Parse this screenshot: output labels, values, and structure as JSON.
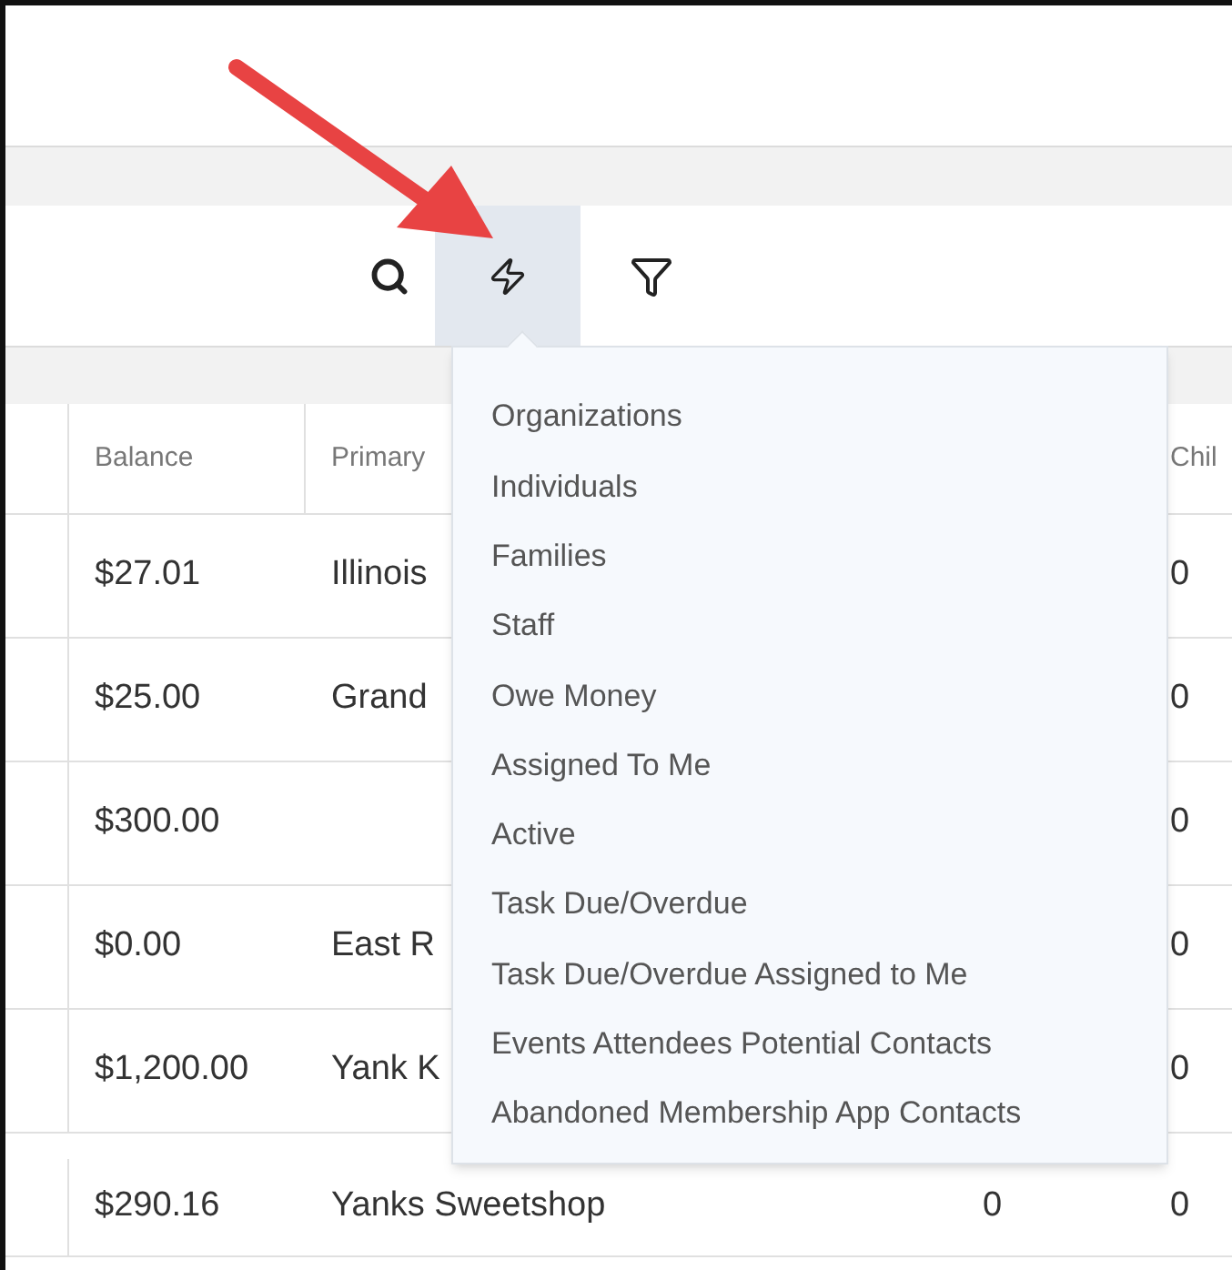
{
  "toolbar": {
    "buttons": [
      {
        "kind": "search",
        "selected": false
      },
      {
        "kind": "quick_filter",
        "selected": true
      },
      {
        "kind": "filter",
        "selected": false
      }
    ]
  },
  "table": {
    "headers": {
      "balance": "Balance",
      "primary": "Primary",
      "column_4": "Chil"
    },
    "rows": [
      {
        "balance": "$27.01",
        "primary": "Illinois",
        "column_4": "0"
      },
      {
        "balance": "$25.00",
        "primary": "Grand",
        "column_4": "0"
      },
      {
        "balance": "$300.00",
        "column_4": "0"
      },
      {
        "balance": "$0.00",
        "primary": "East R",
        "column_4": "0"
      },
      {
        "balance": "$1,200.00",
        "primary": "Yank K",
        "column_4": "0"
      },
      {
        "balance": "$290.16",
        "primary": "Yanks Sweetshop",
        "column_3": "0",
        "column_4": "0"
      }
    ]
  },
  "quick_filter_menu": {
    "items": [
      {
        "label": "Organizations"
      },
      {
        "label": "Individuals"
      },
      {
        "label": "Families"
      },
      {
        "label": "Staff"
      },
      {
        "label": "Owe Money"
      },
      {
        "label": "Assigned To Me"
      },
      {
        "label": "Active"
      },
      {
        "label": "Task Due/Overdue"
      },
      {
        "label": "Task Due/Overdue Assigned to Me"
      },
      {
        "label": "Events Attendees Potential Contacts"
      },
      {
        "label": "Abandoned Membership App Contacts"
      }
    ]
  }
}
